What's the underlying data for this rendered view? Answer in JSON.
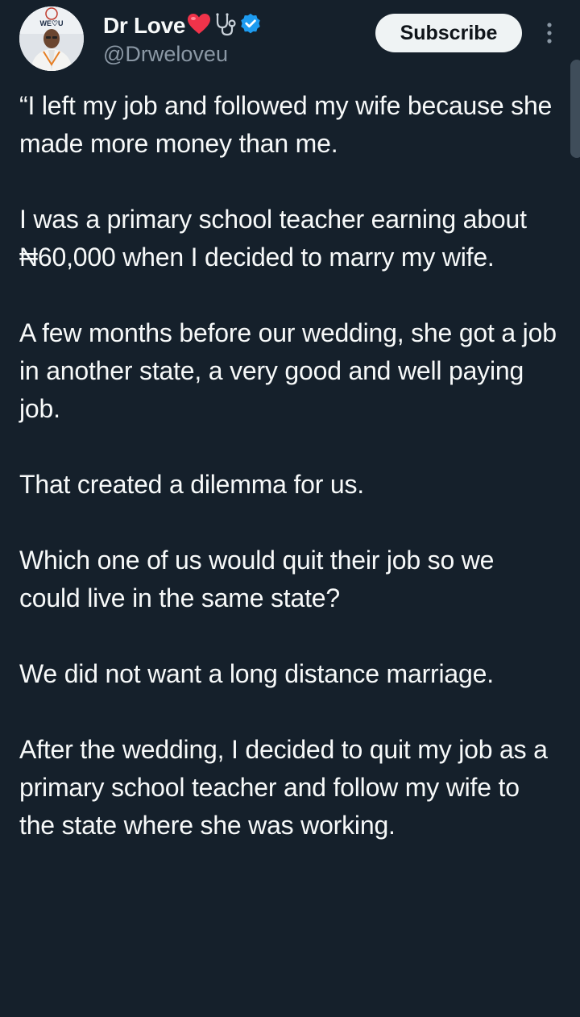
{
  "author": {
    "display_name": "Dr Love",
    "heart_emoji": "❤️",
    "handle": "@Drweloveu",
    "verified": true,
    "avatar_logo_text": "WE♡U"
  },
  "actions": {
    "subscribe_label": "Subscribe",
    "more_icon": "more-vertical-icon"
  },
  "tweet": {
    "paragraphs": [
      "“I left my job and followed my wife because she made more money than me.",
      "I was a primary school teacher earning about ₦60,000 when I decided to marry my wife.",
      "A few months before our wedding, she got a job in another state, a very good and well paying job.",
      "That created a dilemma for us.",
      "Which one of us would quit their job so we could live in the same state?",
      "We did not want a long distance marriage.",
      "After the wedding, I decided to quit my job as a primary school teacher and follow my wife to the state where she was working."
    ]
  },
  "colors": {
    "background": "#15202b",
    "text": "#f7f9f9",
    "muted": "#8b98a5",
    "verified": "#1d9bf0",
    "subscribe_bg": "#eff3f4"
  }
}
